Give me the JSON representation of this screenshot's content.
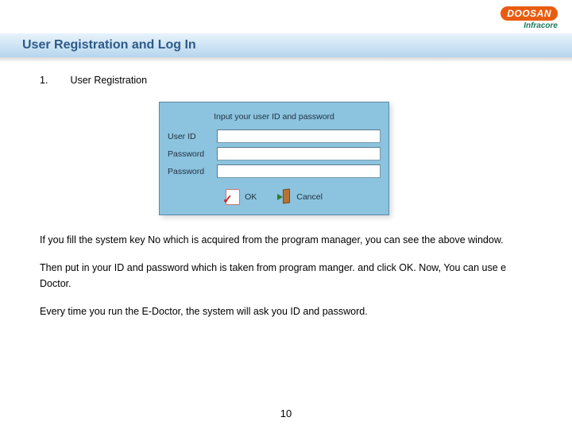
{
  "logo": {
    "main": "DOOSAN",
    "sub": "Infracore"
  },
  "title": "User Registration and Log In",
  "section": {
    "num": "1.",
    "label": "User Registration"
  },
  "dialog": {
    "heading": "Input your user ID and password",
    "fields": {
      "userid": "User ID",
      "password1": "Password",
      "password2": "Password"
    },
    "ok": "OK",
    "cancel": "Cancel"
  },
  "paras": {
    "p1": "If you fill the system key No which is acquired from the program manager, you can see the above window.",
    "p2": "Then put in your ID and password which is taken from program manger. and click OK. Now, You can use e Doctor.",
    "p3": "Every time you run the E-Doctor, the system will ask you ID and password."
  },
  "page": "10"
}
